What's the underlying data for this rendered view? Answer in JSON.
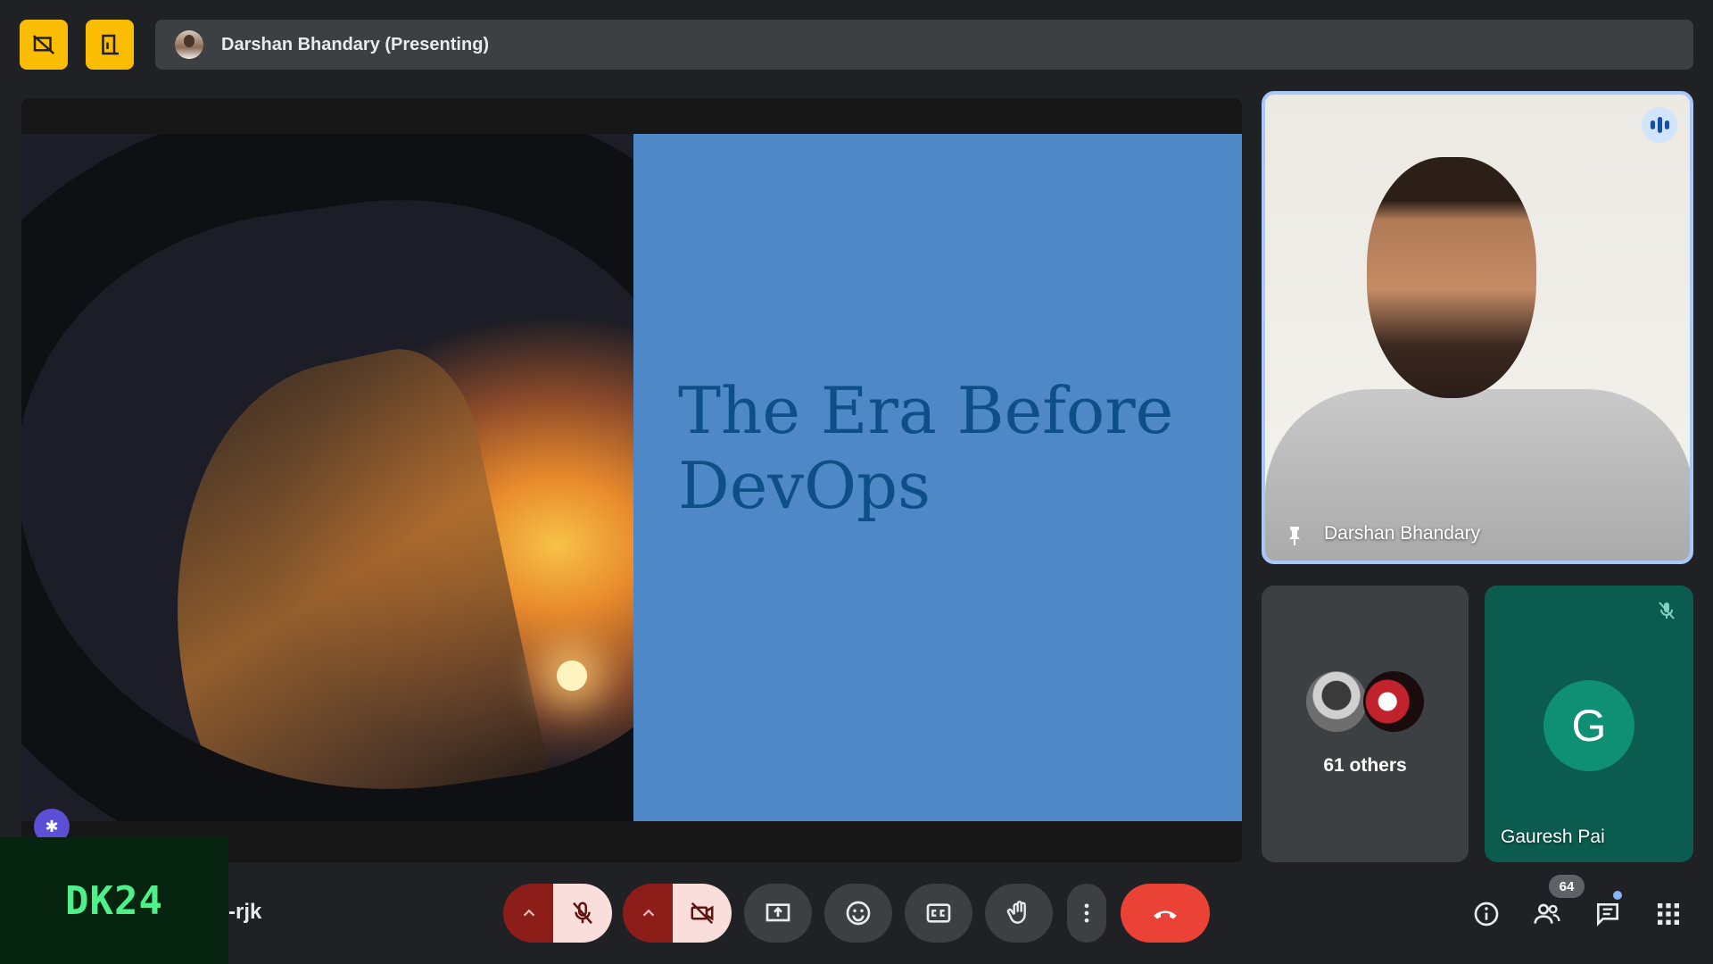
{
  "top_bar": {
    "presenter_label": "Darshan Bhandary (Presenting)"
  },
  "slide": {
    "title_line1": "The Era Before",
    "title_line2": "DevOps"
  },
  "tiles": {
    "speaker_name": "Darshan Bhandary",
    "others_label": "61 others",
    "gauresh_initial": "G",
    "gauresh_name": "Gauresh Pai"
  },
  "bottom_bar": {
    "brand": "DK24",
    "meeting_code_fragment": "-rjk",
    "participant_count": "64"
  },
  "colors": {
    "accent_yellow": "#fbbc04",
    "end_call_red": "#ea4335",
    "muted_red": "#8c1d18",
    "slide_blue": "#4e88c7",
    "brand_green": "#4ff08a"
  }
}
